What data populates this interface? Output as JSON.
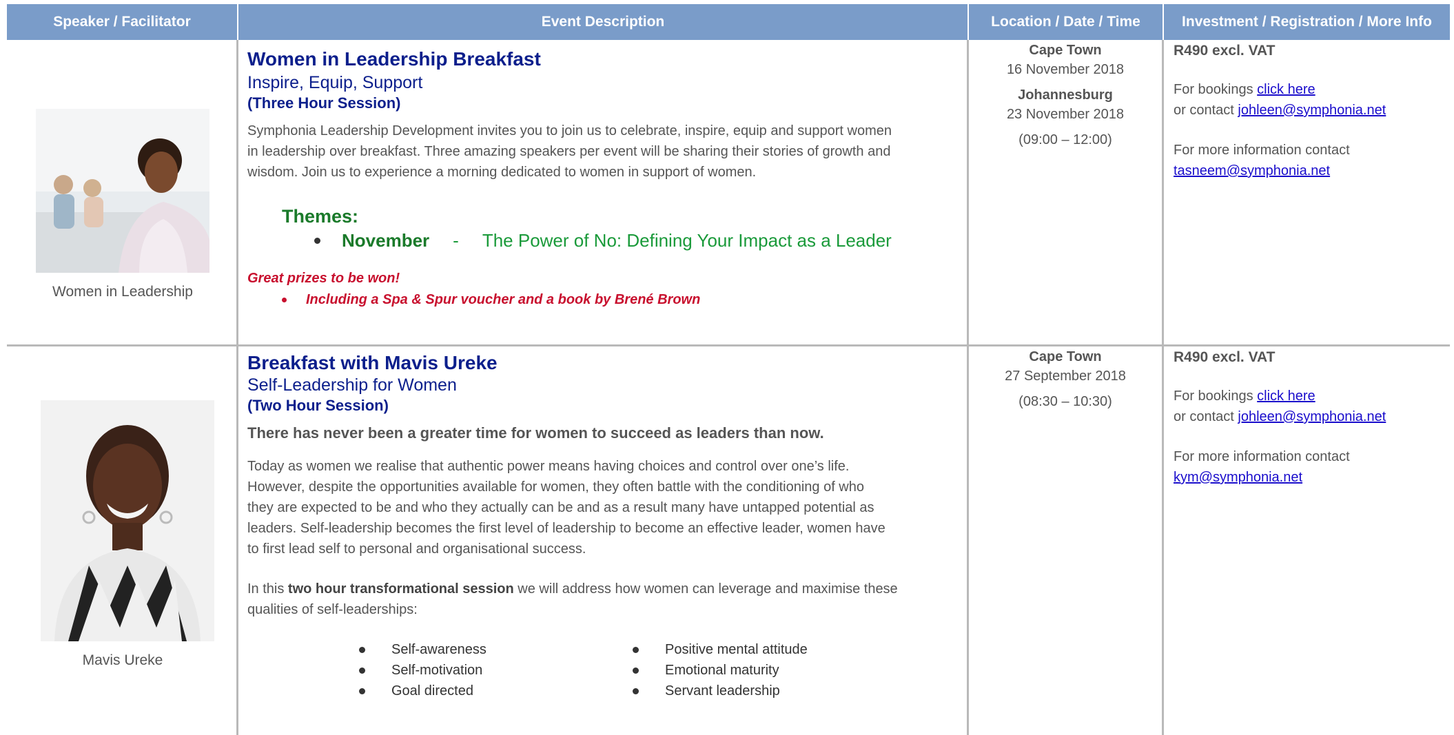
{
  "header": {
    "speaker": "Speaker / Facilitator",
    "description": "Event Description",
    "location": "Location / Date / Time",
    "investment": "Investment / Registration / More Info"
  },
  "events": [
    {
      "speaker_caption": "Women in Leadership",
      "title": "Women in Leadership Breakfast",
      "subtitle": "Inspire, Equip, Support",
      "session": "(Three Hour Session)",
      "description_lines": [
        "Symphonia Leadership Development invites you to join us to celebrate, inspire, equip and support women",
        "in leadership over breakfast.   Three amazing speakers per event will be sharing their stories of growth and",
        "wisdom.  Join us to experience a morning dedicated to women in support of women."
      ],
      "themes_heading": "Themes:",
      "theme_month": "November",
      "theme_dash": "-",
      "theme_text": "The Power of No:  Defining Your Impact as a Leader",
      "prize_heading": "Great prizes to be won!",
      "prize_item": "Including a Spa & Spur voucher and a book by Brené Brown",
      "locations": [
        {
          "city": "Cape Town",
          "date": "16 November 2018"
        },
        {
          "city": "Johannesburg",
          "date": "23 November 2018"
        }
      ],
      "time": "(09:00 – 12:00)",
      "price": "R490 excl. VAT",
      "bookings_prefix": "For bookings ",
      "bookings_link": "click here",
      "contact_prefix": "or contact ",
      "contact_email": "johleen@symphonia.net",
      "more_info": "For more information contact",
      "more_info_email": "tasneem@symphonia.net"
    },
    {
      "speaker_caption": "Mavis Ureke",
      "title": "Breakfast with Mavis Ureke",
      "subtitle": "Self-Leadership for Women",
      "session": "(Two Hour Session)",
      "lead": "There has never been a greater time for women to succeed as leaders than now.",
      "description_lines": [
        "Today as women we realise that authentic power means having choices and control over one’s life.",
        "However, despite the opportunities available for women, they often battle with the conditioning of who",
        "they are expected to be and who they actually can be and as a result many have untapped potential as",
        "leaders. Self-leadership becomes the first level of leadership to become an effective leader, women have",
        "to first lead self to personal and organisational success."
      ],
      "session_intro_prefix": "In this ",
      "session_intro_bold": "two hour transformational session",
      "session_intro_suffix": " we will address how women can leverage and maximise  these",
      "session_intro_line2": "qualities of self-leaderships:",
      "qualities_left": [
        "Self-awareness",
        "Self-motivation",
        "Goal directed"
      ],
      "qualities_right": [
        "Positive mental attitude",
        "Emotional maturity",
        "Servant leadership"
      ],
      "locations": [
        {
          "city": "Cape Town",
          "date": "27 September 2018"
        }
      ],
      "time": "(08:30 – 10:30)",
      "price": "R490 excl. VAT",
      "bookings_prefix": "For bookings ",
      "bookings_link": "click here",
      "contact_prefix": "or contact ",
      "contact_email": "johleen@symphonia.net",
      "more_info": "For more information contact",
      "more_info_email": "kym@symphonia.net"
    }
  ]
}
